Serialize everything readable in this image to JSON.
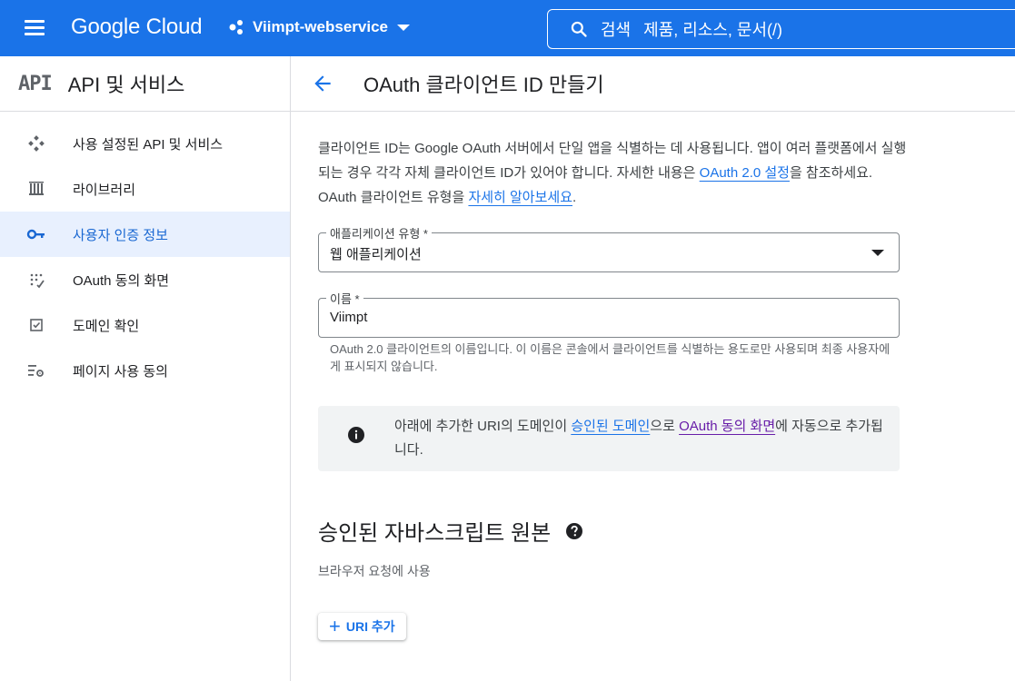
{
  "topbar": {
    "brand": "Google Cloud",
    "project": "Viimpt-webservice",
    "search_label": "검색",
    "search_hint": "제품, 리소스, 문서(/)"
  },
  "sidebar": {
    "logo": "API",
    "title": "API 및 서비스",
    "items": [
      {
        "label": "사용 설정된 API 및 서비스",
        "icon": "diamond-nodes-icon"
      },
      {
        "label": "라이브러리",
        "icon": "library-icon"
      },
      {
        "label": "사용자 인증 정보",
        "icon": "key-icon",
        "active": true
      },
      {
        "label": "OAuth 동의 화면",
        "icon": "consent-dots-icon"
      },
      {
        "label": "도메인 확인",
        "icon": "checkbox-icon"
      },
      {
        "label": "페이지 사용 동의",
        "icon": "settings-list-icon"
      }
    ]
  },
  "main": {
    "title": "OAuth 클라이언트 ID 만들기",
    "desc_part1": "클라이언트 ID는 Google OAuth 서버에서 단일 앱을 식별하는 데 사용됩니다. 앱이 여러 플랫폼에서 실행되는 경우 각각 자체 클라이언트 ID가 있어야 합니다. 자세한 내용은 ",
    "desc_link1": "OAuth 2.0 설정",
    "desc_part2": "을 참조하세요. OAuth 클라이언트 유형을 ",
    "desc_link2": "자세히 알아보세요",
    "desc_part3": ".",
    "app_type": {
      "label": "애플리케이션 유형 *",
      "value": "웹 애플리케이션"
    },
    "name": {
      "label": "이름 *",
      "value": "Viimpt"
    },
    "name_hint": "OAuth 2.0 클라이언트의 이름입니다. 이 이름은 콘솔에서 클라이언트를 식별하는 용도로만 사용되며 최종 사용자에게 표시되지 않습니다.",
    "info_part1": "아래에 추가한 URI의 도메인이 ",
    "info_link1": "승인된 도메인",
    "info_part2": "으로 ",
    "info_link2": "OAuth 동의 화면",
    "info_part3": "에 자동으로 추가됩니다.",
    "section_title": "승인된 자바스크립트 원본",
    "section_sub": "브라우저 요청에 사용",
    "add_uri_label": "URI 추가"
  },
  "colors": {
    "brand_blue": "#1a73e8",
    "active_bg": "#e8f0fe",
    "visited_link": "#681da8"
  }
}
